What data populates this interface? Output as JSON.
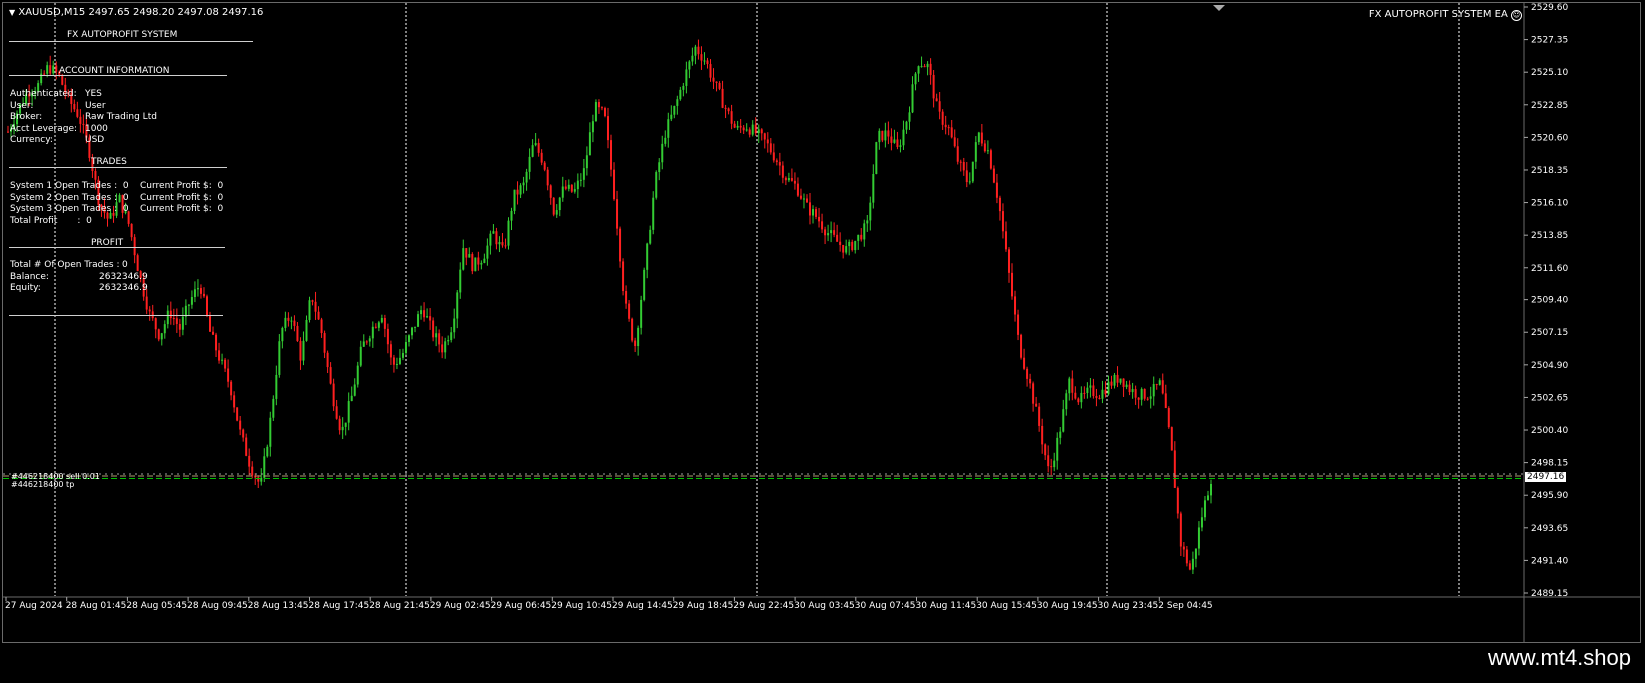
{
  "header": {
    "symbol": "XAUUSD,M15",
    "ohlc": "2497.65 2498.20 2497.08 2497.16",
    "ea_name": "FX AUTOPROFIT SYSTEM EA",
    "smiley_icon": "smiley-icon"
  },
  "panel": {
    "title": "FX AUTOPROFIT SYSTEM",
    "account_heading": "ACCOUNT INFORMATION",
    "rows": [
      {
        "label": "Authenticated:",
        "value": "YES"
      },
      {
        "label": "User:",
        "value": "User"
      },
      {
        "label": "Broker:",
        "value": "Raw Trading Ltd"
      },
      {
        "label": "Acct Leverage:",
        "value": "1000"
      },
      {
        "label": "Currency:",
        "value": "USD"
      }
    ],
    "trades_heading": "TRADES",
    "trades": [
      {
        "text": "System 1 Open Trades :  0    Current Profit $:  0"
      },
      {
        "text": "System 2 Open Trades :  0    Current Profit $:  0"
      },
      {
        "text": "System 3 Open Trades :  0    Current Profit $:  0"
      },
      {
        "text": "Total Profit       :  0"
      }
    ],
    "profit_heading": "PROFIT",
    "profit_rows": [
      {
        "label": "Total # Of Open Trades :",
        "value": "0"
      },
      {
        "label": "Balance:",
        "value": "2632346.9"
      },
      {
        "label": "Equity:",
        "value": "2632346.9"
      }
    ]
  },
  "order_tags": {
    "top": "#446218400 sell 0.01",
    "bottom": "#446218400 tp"
  },
  "current_price_label": "2497.16",
  "watermark": "www.mt4.shop",
  "colors": {
    "bull": "#33cc33",
    "bear": "#ff2020",
    "bid_line": "#b0a070",
    "tp_line": "#00c000",
    "grid": "#ffffff"
  },
  "chart_data": {
    "type": "candlestick",
    "y_ticks": [
      "2529.60",
      "2527.35",
      "2525.10",
      "2522.85",
      "2520.60",
      "2518.35",
      "2516.10",
      "2513.85",
      "2511.60",
      "2509.40",
      "2507.15",
      "2504.90",
      "2502.65",
      "2500.40",
      "2498.15",
      "2495.90",
      "2493.65",
      "2491.40",
      "2489.15"
    ],
    "x_ticks": [
      "27 Aug 2024",
      "28 Aug 01:45",
      "28 Aug 05:45",
      "28 Aug 09:45",
      "28 Aug 13:45",
      "28 Aug 17:45",
      "28 Aug 21:45",
      "29 Aug 02:45",
      "29 Aug 06:45",
      "29 Aug 10:45",
      "29 Aug 14:45",
      "29 Aug 18:45",
      "29 Aug 22:45",
      "30 Aug 03:45",
      "30 Aug 07:45",
      "30 Aug 11:45",
      "30 Aug 15:45",
      "30 Aug 19:45",
      "30 Aug 23:45",
      "2 Sep 04:45"
    ],
    "ylim": [
      2489.15,
      2529.6
    ],
    "current_price": 2497.16,
    "path": [
      2521,
      2522.5,
      2523.8,
      2524.2,
      2525.5,
      2524.9,
      2523.2,
      2522.1,
      2519.8,
      2516.2,
      2514.8,
      2516.4,
      2514.5,
      2511.1,
      2508.4,
      2506.9,
      2508.6,
      2507.4,
      2509.3,
      2510.5,
      2507.1,
      2505.2,
      2503.4,
      2500.1,
      2497.9,
      2496.5,
      2501.3,
      2507.2,
      2508.4,
      2505.3,
      2509.8,
      2507.2,
      2503.1,
      2500.2,
      2502.7,
      2506.1,
      2507.4,
      2508.5,
      2504.8,
      2505.6,
      2507.3,
      2508.9,
      2507.1,
      2506.0,
      2507.8,
      2513.1,
      2511.7,
      2512.4,
      2514.0,
      2512.6,
      2516.5,
      2517.3,
      2520.2,
      2518.9,
      2515.5,
      2517.1,
      2516.8,
      2518.3,
      2522.7,
      2522.1,
      2516.4,
      2509.2,
      2506.1,
      2511.5,
      2517.4,
      2520.9,
      2522.7,
      2524.9,
      2526.8,
      2525.9,
      2524.1,
      2522.6,
      2521.1,
      2521.4,
      2520.9,
      2520.2,
      2519.1,
      2517.8,
      2517.2,
      2515.8,
      2515.1,
      2514.1,
      2513.4,
      2512.8,
      2513.6,
      2514.5,
      2520.6,
      2520.9,
      2519.7,
      2522.1,
      2525.9,
      2525.5,
      2522.2,
      2521.3,
      2518.9,
      2517.4,
      2520.9,
      2519.6,
      2516.1,
      2511.2,
      2506.3,
      2503.8,
      2500.7,
      2497.3,
      2500.2,
      2503.8,
      2502.4,
      2503.1,
      2502.9,
      2503.6,
      2504.1,
      2503.2,
      2502.8,
      2502.9,
      2503.6,
      2499.6,
      2492.6,
      2490.6,
      2494.2,
      2497.1
    ]
  }
}
